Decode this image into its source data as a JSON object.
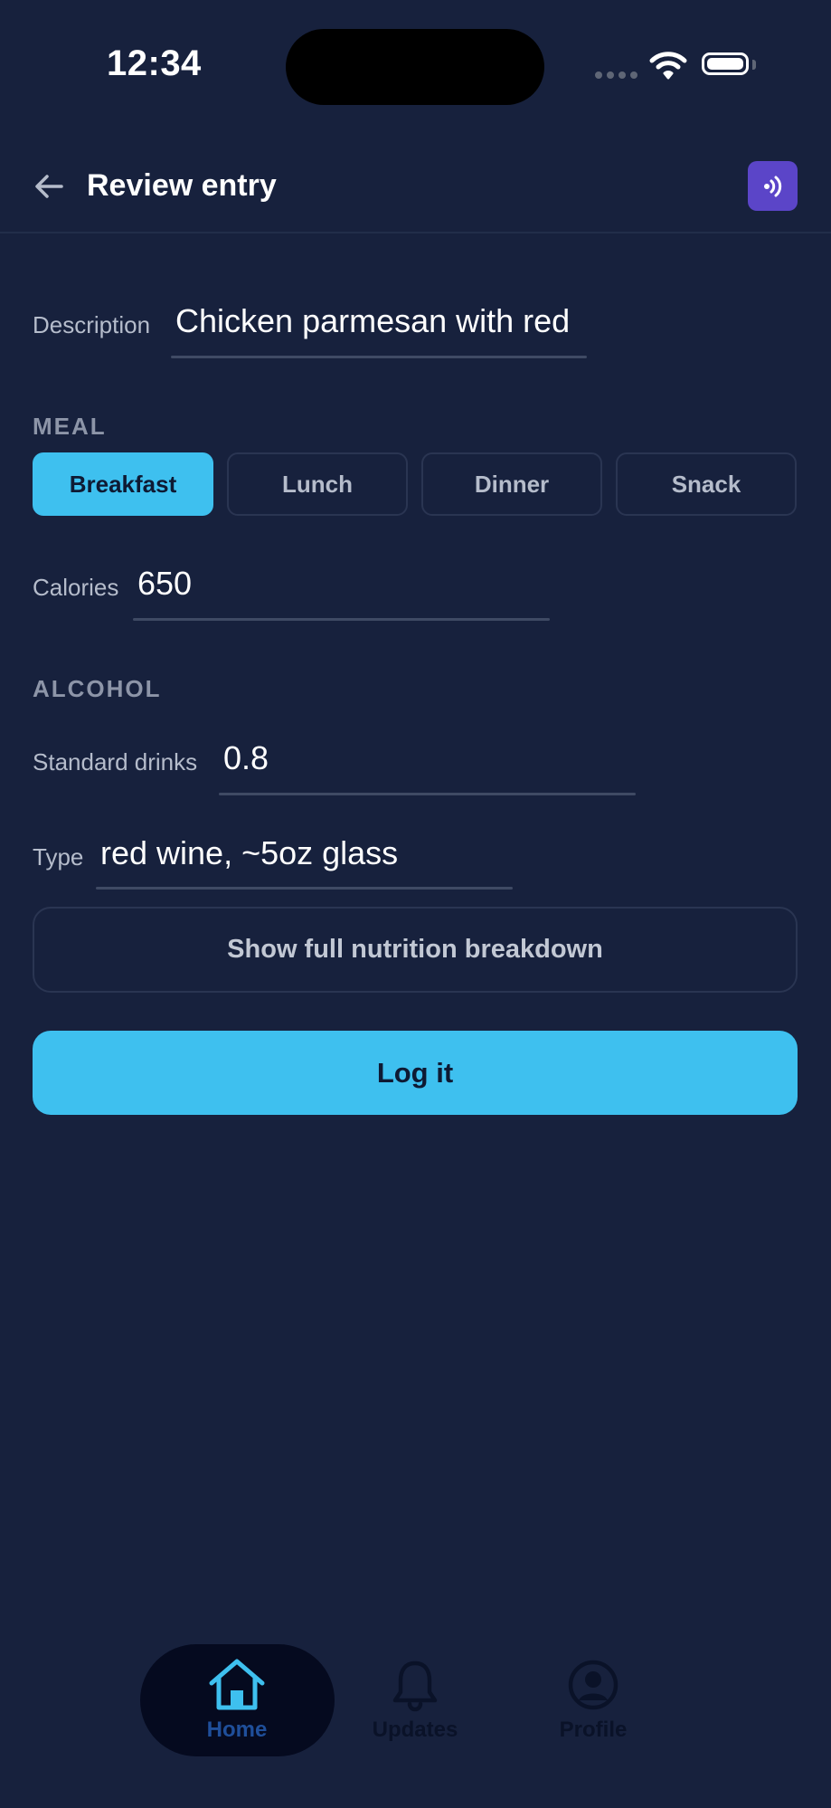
{
  "status_bar": {
    "time": "12:34",
    "icons": [
      "signal-icon",
      "wifi-icon",
      "battery-icon"
    ]
  },
  "header": {
    "title": "Review entry",
    "back_icon": "arrow-left-icon",
    "action_icon": "voice-icon"
  },
  "form": {
    "description": {
      "label": "Description",
      "value": "Chicken parmesan with red"
    },
    "meal": {
      "section_label": "MEAL",
      "options": [
        "Breakfast",
        "Lunch",
        "Dinner",
        "Snack"
      ],
      "selected": "Breakfast"
    },
    "calories": {
      "label": "Calories",
      "value": "650"
    },
    "alcohol": {
      "section_label": "ALCOHOL",
      "standard_drinks": {
        "label": "Standard drinks",
        "value": "0.8"
      },
      "type": {
        "label": "Type",
        "value": "red wine, ~5oz glass"
      }
    },
    "breakdown_button": "Show full nutrition breakdown",
    "submit_button": "Log it"
  },
  "bottom_nav": {
    "items": [
      {
        "label": "Home",
        "icon": "home-icon",
        "active": true
      },
      {
        "label": "Updates",
        "icon": "bell-icon",
        "active": false
      },
      {
        "label": "Profile",
        "icon": "profile-icon",
        "active": false
      }
    ]
  },
  "colors": {
    "background": "#17213d",
    "accent": "#3ec0ef",
    "voice_button": "#5b45c8",
    "nav_inactive": "#050a1f"
  }
}
